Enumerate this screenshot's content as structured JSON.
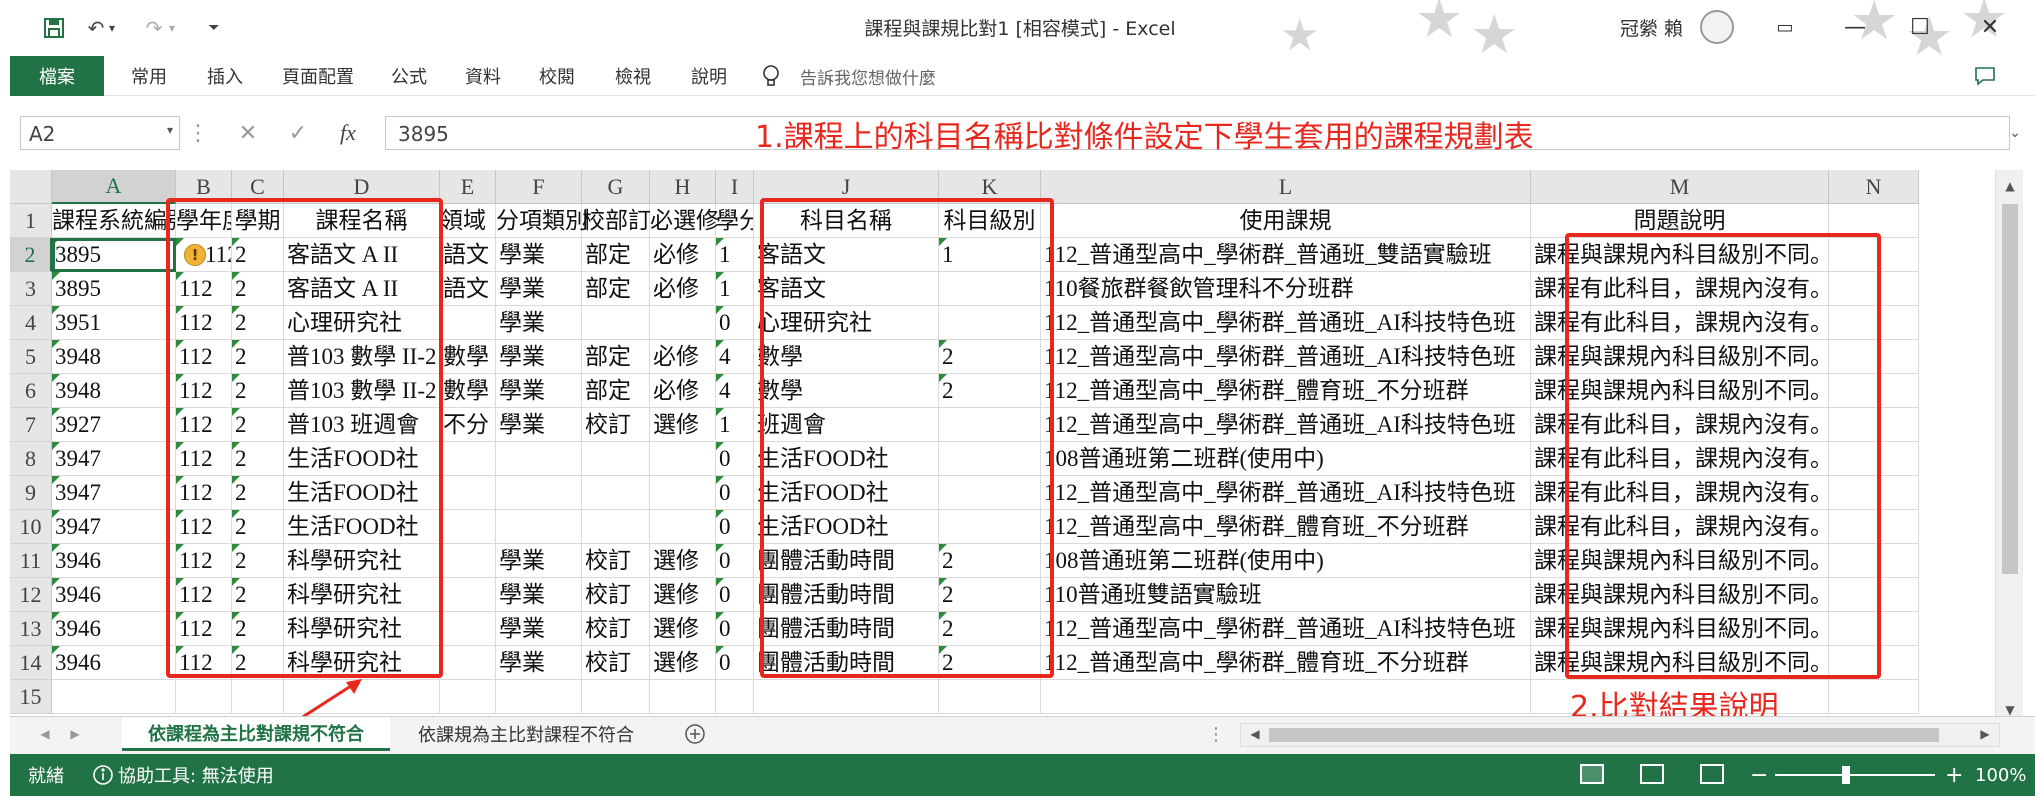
{
  "titlebar": {
    "document_title": "課程與課規比對1  [相容模式]  -  Excel",
    "user_name": "冠縈 賴",
    "save_icon": "save-icon",
    "undo_icon": "undo-icon",
    "redo_icon": "redo-icon"
  },
  "ribbon": {
    "tabs": [
      "檔案",
      "常用",
      "插入",
      "頁面配置",
      "公式",
      "資料",
      "校閱",
      "檢視",
      "說明"
    ],
    "tell_me": "告訴我您想做什麼"
  },
  "formula_bar": {
    "name_box": "A2",
    "fx_label": "fx",
    "value": "3895"
  },
  "annotations": {
    "top": "1.課程上的科目名稱比對條件設定下學生套用的課程規劃表",
    "bottom": "2.比對結果說明"
  },
  "grid": {
    "columns": [
      "A",
      "B",
      "C",
      "D",
      "E",
      "F",
      "G",
      "H",
      "I",
      "J",
      "K",
      "L",
      "M",
      "N"
    ],
    "row_numbers": [
      "1",
      "2",
      "3",
      "4",
      "5",
      "6",
      "7",
      "8",
      "9",
      "10",
      "11",
      "12",
      "13",
      "14",
      "15"
    ],
    "header": [
      "課程系統編號",
      "學年度",
      "學期",
      "課程名稱",
      "領域",
      "分項類別",
      "校部訂",
      "必選修",
      "學分",
      "科目名稱",
      "科目級別",
      "使用課規",
      "問題說明",
      ""
    ],
    "rows": [
      [
        "3895",
        "112",
        "2",
        "客語文 A  II",
        "語文",
        "學業",
        "部定",
        "必修",
        "1",
        "客語文",
        "1",
        "112_普通型高中_學術群_普通班_雙語實驗班",
        "課程與課規內科目級別不同。",
        ""
      ],
      [
        "3895",
        "112",
        "2",
        "客語文 A  II",
        "語文",
        "學業",
        "部定",
        "必修",
        "1",
        "客語文",
        "",
        "110餐旅群餐飲管理科不分班群",
        "課程有此科目，課規內沒有。",
        ""
      ],
      [
        "3951",
        "112",
        "2",
        "心理研究社",
        "",
        "學業",
        "",
        "",
        "0",
        "心理研究社",
        "",
        "112_普通型高中_學術群_普通班_AI科技特色班",
        "課程有此科目，課規內沒有。",
        ""
      ],
      [
        "3948",
        "112",
        "2",
        "普103 數學 II-2",
        "數學",
        "學業",
        "部定",
        "必修",
        "4",
        "數學",
        "2",
        "112_普通型高中_學術群_普通班_AI科技特色班",
        "課程與課規內科目級別不同。",
        ""
      ],
      [
        "3948",
        "112",
        "2",
        "普103 數學 II-2",
        "數學",
        "學業",
        "部定",
        "必修",
        "4",
        "數學",
        "2",
        "112_普通型高中_學術群_體育班_不分班群",
        "課程與課規內科目級別不同。",
        ""
      ],
      [
        "3927",
        "112",
        "2",
        "普103 班週會",
        "不分",
        "學業",
        "校訂",
        "選修",
        "1",
        "班週會",
        "",
        "112_普通型高中_學術群_普通班_AI科技特色班",
        "課程有此科目，課規內沒有。",
        ""
      ],
      [
        "3947",
        "112",
        "2",
        "生活FOOD社",
        "",
        "",
        "",
        "",
        "0",
        "生活FOOD社",
        "",
        "108普通班第二班群(使用中)",
        "課程有此科目，課規內沒有。",
        ""
      ],
      [
        "3947",
        "112",
        "2",
        "生活FOOD社",
        "",
        "",
        "",
        "",
        "0",
        "生活FOOD社",
        "",
        "112_普通型高中_學術群_普通班_AI科技特色班",
        "課程有此科目，課規內沒有。",
        ""
      ],
      [
        "3947",
        "112",
        "2",
        "生活FOOD社",
        "",
        "",
        "",
        "",
        "0",
        "生活FOOD社",
        "",
        "112_普通型高中_學術群_體育班_不分班群",
        "課程有此科目，課規內沒有。",
        ""
      ],
      [
        "3946",
        "112",
        "2",
        "科學研究社",
        "",
        "學業",
        "校訂",
        "選修",
        "0",
        "團體活動時間",
        "2",
        "108普通班第二班群(使用中)",
        "課程與課規內科目級別不同。",
        ""
      ],
      [
        "3946",
        "112",
        "2",
        "科學研究社",
        "",
        "學業",
        "校訂",
        "選修",
        "0",
        "團體活動時間",
        "2",
        "110普通班雙語實驗班",
        "課程與課規內科目級別不同。",
        ""
      ],
      [
        "3946",
        "112",
        "2",
        "科學研究社",
        "",
        "學業",
        "校訂",
        "選修",
        "0",
        "團體活動時間",
        "2",
        "112_普通型高中_學術群_普通班_AI科技特色班",
        "課程與課規內科目級別不同。",
        ""
      ],
      [
        "3946",
        "112",
        "2",
        "科學研究社",
        "",
        "學業",
        "校訂",
        "選修",
        "0",
        "團體活動時間",
        "2",
        "112_普通型高中_學術群_體育班_不分班群",
        "課程與課規內科目級別不同。",
        ""
      ]
    ]
  },
  "sheet_tabs": [
    "依課程為主比對課規不符合",
    "依課規為主比對課程不符合"
  ],
  "status_bar": {
    "ready": "就緒",
    "accessibility": "協助工具: 無法使用",
    "zoom": "100%"
  },
  "colors": {
    "excel_green": "#217346",
    "annotation_red": "#e8271e",
    "header_gray": "#e6e6e6"
  }
}
